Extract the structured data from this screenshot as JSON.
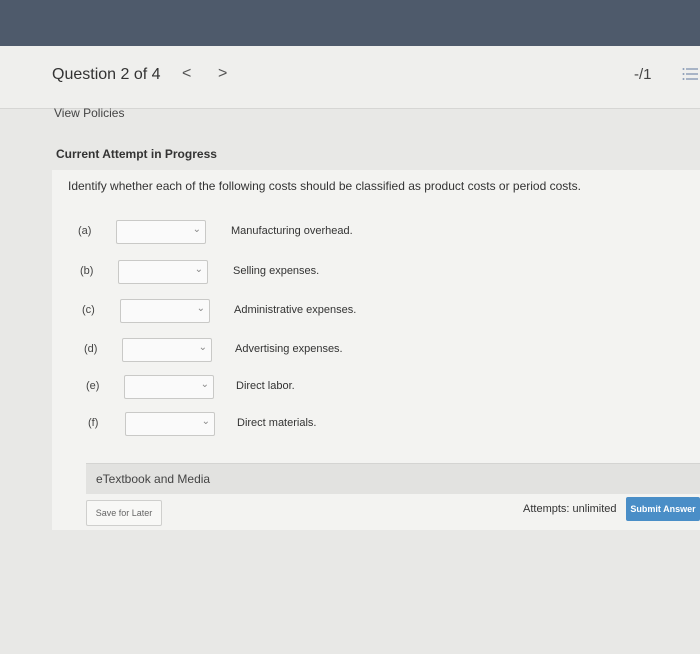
{
  "header": {
    "question_label": "Question 2 of 4",
    "prev_arrow": "<",
    "next_arrow": ">",
    "score": "-/1",
    "list_icon": "list-icon"
  },
  "policies_link": "View Policies",
  "attempt_title": "Current Attempt in Progress",
  "instruction": "Identify whether each of the following costs should be classified as product costs or period costs.",
  "items": [
    {
      "label": "(a)",
      "selected": "",
      "description": "Manufacturing overhead."
    },
    {
      "label": "(b)",
      "selected": "",
      "description": "Selling expenses."
    },
    {
      "label": "(c)",
      "selected": "",
      "description": "Administrative expenses."
    },
    {
      "label": "(d)",
      "selected": "",
      "description": "Advertising expenses."
    },
    {
      "label": "(e)",
      "selected": "",
      "description": "Direct labor."
    },
    {
      "label": "(f)",
      "selected": "",
      "description": "Direct materials."
    }
  ],
  "etextbook": "eTextbook and Media",
  "save_button": "Save for Later",
  "attempts": "Attempts: unlimited",
  "submit_button": "Submit Answer",
  "colors": {
    "topbar": "#4e5a6b",
    "submit": "#4a8ec7"
  }
}
